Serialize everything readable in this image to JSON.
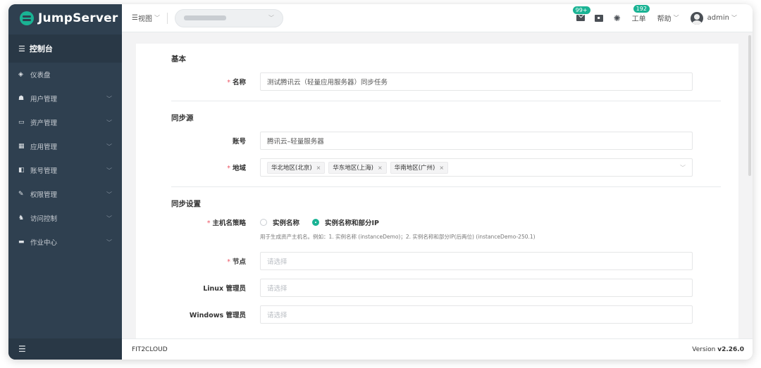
{
  "brand": {
    "name": "JumpServer"
  },
  "sidebar": {
    "title": "控制台",
    "items": [
      {
        "icon": "dashboard-icon",
        "label": "仪表盘",
        "expandable": false
      },
      {
        "icon": "users-icon",
        "label": "用户管理",
        "expandable": true
      },
      {
        "icon": "assets-icon",
        "label": "资产管理",
        "expandable": true
      },
      {
        "icon": "apps-icon",
        "label": "应用管理",
        "expandable": true
      },
      {
        "icon": "accounts-icon",
        "label": "账号管理",
        "expandable": true
      },
      {
        "icon": "permission-icon",
        "label": "权限管理",
        "expandable": true
      },
      {
        "icon": "acl-icon",
        "label": "访问控制",
        "expandable": true
      },
      {
        "icon": "jobs-icon",
        "label": "作业中心",
        "expandable": true
      }
    ]
  },
  "header": {
    "view_label": "视图",
    "messages_badge": "99+",
    "tickets_badge": "192",
    "tickets_label": "工单",
    "help_label": "帮助",
    "user_name": "admin"
  },
  "form": {
    "section_basic": "基本",
    "name_label": "名称",
    "name_value": "测试腾讯云（轻量应用服务器）同步任务",
    "section_source": "同步源",
    "account_label": "账号",
    "account_value": "腾讯云–轻量服务器",
    "region_label": "地域",
    "regions": [
      "华北地区(北京)",
      "华东地区(上海)",
      "华南地区(广州)"
    ],
    "section_settings": "同步设置",
    "hostname_label": "主机名策略",
    "hostname_options": [
      "实例名称",
      "实例名称和部分IP"
    ],
    "hostname_selected": "实例名称和部分IP",
    "hostname_help": "用于生成资产主机名。例如：1. 实例名称 (instanceDemo)；2. 实例名称和部分IP(后两位) (instanceDemo-250.1)",
    "node_label": "节点",
    "node_placeholder": "请选择",
    "linux_admin_label": "Linux 管理员",
    "linux_admin_placeholder": "请选择",
    "windows_admin_label": "Windows 管理员",
    "windows_admin_placeholder": "请选择"
  },
  "footer": {
    "company": "FIT2CLOUD",
    "version_prefix": "Version",
    "version": "v2.26.0"
  },
  "colors": {
    "accent": "#1ab394",
    "sidebar_bg": "#2f4050",
    "required": "#ed5565"
  }
}
